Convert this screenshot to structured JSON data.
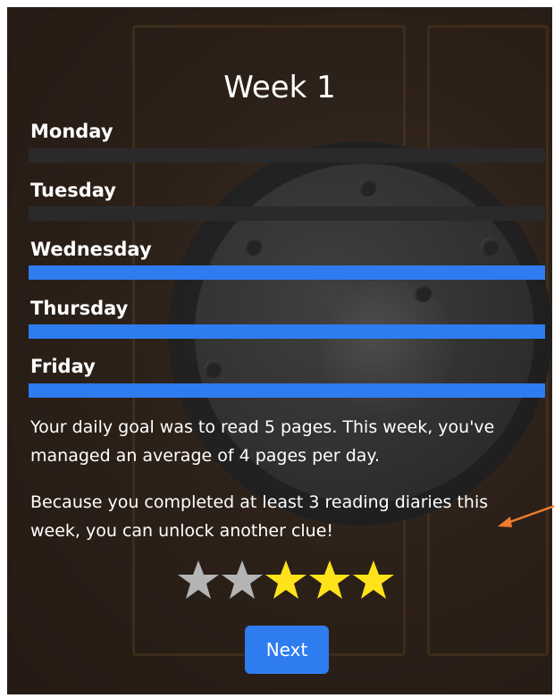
{
  "title": "Week 1",
  "days": [
    {
      "label": "Monday",
      "completed": false
    },
    {
      "label": "Tuesday",
      "completed": false
    },
    {
      "label": "Wednesday",
      "completed": true
    },
    {
      "label": "Thursday",
      "completed": true
    },
    {
      "label": "Friday",
      "completed": true
    }
  ],
  "colors": {
    "completed": "#2f7cf0",
    "incomplete": "#2a2a2c",
    "star_filled": "#ffe31a",
    "star_empty": "#b4b4b4",
    "button": "#2f7cf0",
    "annotation_arrow": "#ef7d2d"
  },
  "messages": {
    "goal": "Your daily goal was to read 5 pages. This week, you've managed an average of 4 pages per day.",
    "unlock": "Because you completed at least 3 reading diaries this week, you can unlock another clue!"
  },
  "rating": {
    "filled": 3,
    "total": 5
  },
  "next_button": {
    "label": "Next"
  }
}
